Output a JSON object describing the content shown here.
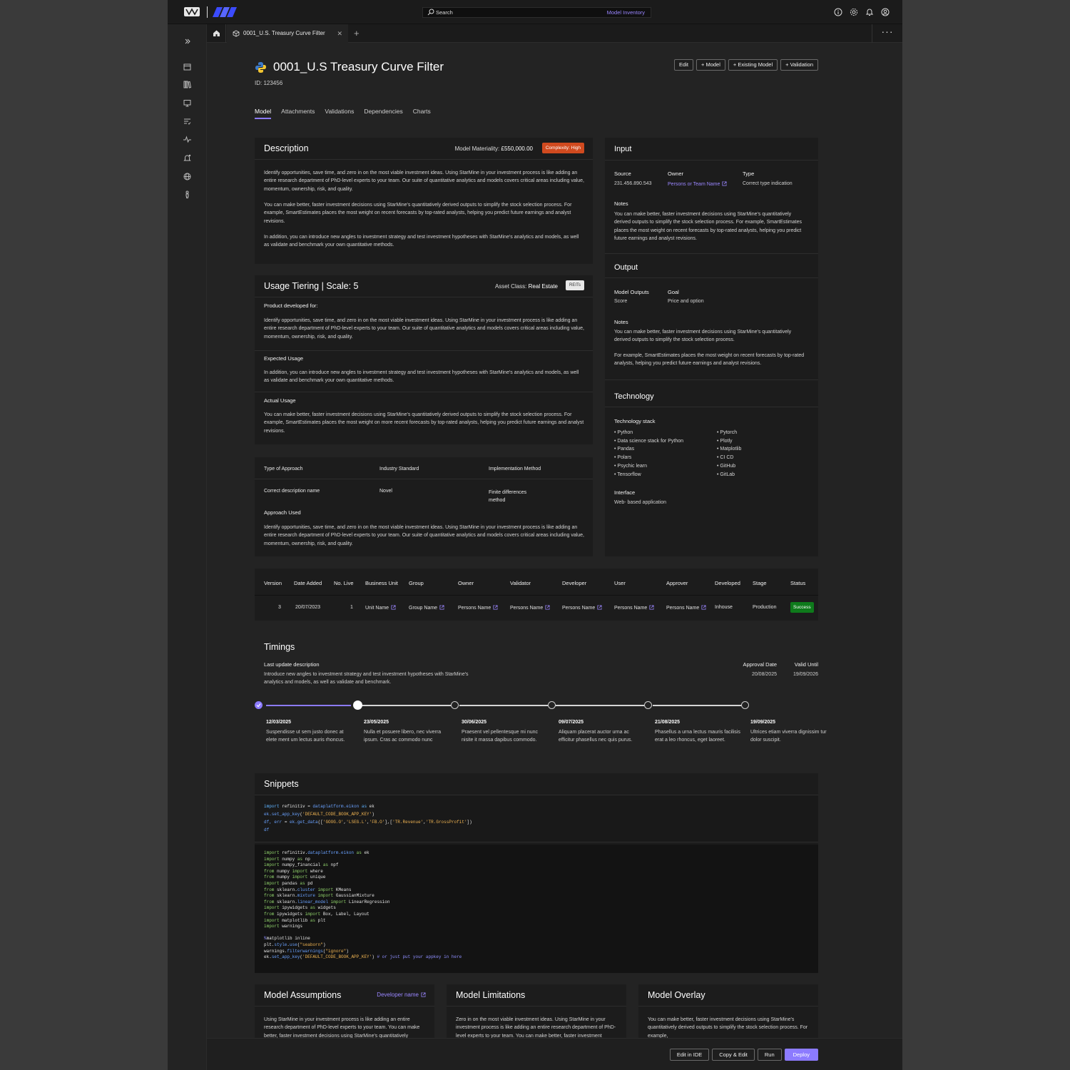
{
  "header": {
    "search_placeholder": "Search",
    "search_scope": "Model Inventory"
  },
  "tabbar": {
    "active_tab": "0001_U.S. Treasury Curve Filter",
    "close": "✕",
    "add": "+",
    "more": "···"
  },
  "page": {
    "title": "0001_U.S Treasury Curve Filter",
    "id": "ID: 123456",
    "actions": [
      "Edit",
      "+ Model",
      "+ Existing Model",
      "+ Validation"
    ],
    "tabs": [
      "Model",
      "Attachments",
      "Validations",
      "Dependencies",
      "Charts"
    ]
  },
  "description": {
    "title": "Description",
    "materiality_label": "Model Materiality:",
    "materiality_value": "£550,000.00",
    "complexity": "Complexity: High",
    "paragraphs": [
      "Identify opportunities, save time, and zero in on the most viable investment ideas. Using StarMine in your investment process is like adding an entire research department of PhD-level experts to your team. Our suite of quantitative analytics and models covers critical areas including value, momentum, ownership, risk, and quality.",
      "You can make better, faster investment decisions using StarMine's quantitatively derived outputs to simplify the stock selection process. For example, SmartEstimates places the most weight on recent forecasts by top-rated analysts, helping you predict future earnings and analyst revisions.",
      "In addition, you can introduce new angles to investment strategy and test investment hypotheses with StarMine's analytics and models, as well as validate and benchmark your own quantitative methods."
    ]
  },
  "usage": {
    "title": "Usage Tiering | Scale: 5",
    "asset_label": "Asset Class:",
    "asset_value": "Real Estate",
    "reits": "REITs",
    "product_label": "Product developed for:",
    "product_text": "Identify opportunities, save time, and zero in on the most viable investment ideas. Using StarMine in your investment process is like adding an entire research department of PhD-level experts to your team. Our suite of quantitative analytics and models covers critical areas including value, momentum, ownership, risk, and quality.",
    "expected_label": "Expected Usage",
    "expected_text": "In addition, you can introduce new angles to investment strategy and test investment hypotheses with StarMine's analytics and models, as well as validate and benchmark your own quantitative methods.",
    "actual_label": "Actual Usage",
    "actual_text": "You can make better, faster investment decisions using StarMine's quantitatively derived outputs to simplify the stock selection process. For example, SmartEstimates places the most weight on more recent forecasts by top-rated analysts, helping you predict future earnings and analyst revisions."
  },
  "approach": {
    "headers": [
      "Type of Approach",
      "Industry Standard",
      "Implementation Method"
    ],
    "values": [
      "Correct description name",
      "Novel",
      "Finite differences method"
    ],
    "used_label": "Approach Used",
    "used_text": "Identify opportunities, save time, and zero in on the most viable investment ideas. Using StarMine in your investment process is like adding an entire research department of PhD-level experts to your team. Our suite of quantitative analytics and models covers critical areas including value, momentum, ownership, risk, and quality."
  },
  "input": {
    "title": "Input",
    "source_label": "Source",
    "source_value": "231.456.890.543",
    "owner_label": "Owner",
    "owner_value": "Persons or Team Name",
    "type_label": "Type",
    "type_value": "Correct type indication",
    "notes_label": "Notes",
    "notes_text": "You can make better, faster investment decisions using StarMine's quantitatively derived outputs to simplify the stock selection process. For example, SmartEstimates places the most weight on recent forecasts by top-rated analysts, helping you predict future earnings and analyst revisions."
  },
  "output": {
    "title": "Output",
    "outputs_label": "Model Outputs",
    "outputs_value": "Score",
    "goal_label": "Goal",
    "goal_value": "Price and option",
    "notes_label": "Notes",
    "notes_text1": "You can make better, faster investment decisions using StarMine's quantitatively derived outputs to simplify the stock selection process.",
    "notes_text2": "For example, SmartEstimates places the most weight on recent forecasts by top-rated analysts, helping you predict future earnings and analyst revisions."
  },
  "technology": {
    "title": "Technology",
    "stack_label": "Technology stack",
    "col1": [
      "• Python",
      "• Data science stack for Python",
      "• Pandas",
      "• Polars",
      "• Psychic learn",
      "• Tensorflow"
    ],
    "col2": [
      "• Pytorch",
      "• Plotly",
      "• Matplotlib",
      "• CI CD",
      "• GitHub",
      "• GitLab"
    ],
    "interface_label": "Interface",
    "interface_value": "Web- based application"
  },
  "versions": {
    "headers": [
      "Version",
      "Date Added",
      "No. Live",
      "Business Unit",
      "Group",
      "Owner",
      "Validator",
      "Developer",
      "User",
      "Approver",
      "Developed",
      "Stage",
      "Status"
    ],
    "row": [
      "3",
      "20/07/2023",
      "1",
      "Unit Name",
      "Group Name",
      "Persons Name",
      "Persons Name",
      "Persons Name",
      "Persons Name",
      "Persons Name",
      "Inhouse",
      "Production",
      "Success"
    ]
  },
  "timings": {
    "title": "Timings",
    "last_update_label": "Last update description",
    "last_update_text": "Introduce new angles to investment strategy and test investment hypotheses with StarMine's analytics and models, as well as validate and benchmark.",
    "approval_label": "Approval Date",
    "approval_value": "20/08/2025",
    "valid_label": "Valid Until",
    "valid_value": "19/09/2026",
    "steps": [
      {
        "date": "12/03/2025",
        "text": "Suspendisse ut sem justo donec at elete ment um lectus auris rhoncus."
      },
      {
        "date": "23/05/2025",
        "text": "Nulla et posuere libero, nec viverra ipsum. Cras ac commodo nunc"
      },
      {
        "date": "30/06/2025",
        "text": "Praesent vel pellentesque mi nunc nisite it massa dapibus commodo."
      },
      {
        "date": "09/07/2025",
        "text": "Aliquam placerat auctor urna ac efficitur phasellus nec quis purus."
      },
      {
        "date": "21/08/2025",
        "text": "Phasellus a urna lectus mauris facilisis erat a leo rhoncus, eget laoreet."
      },
      {
        "date": "19/09/2025",
        "text": "Ultrices etiam viverra dignissim tur dolor suscipit."
      }
    ]
  },
  "snippets": {
    "title": "Snippets",
    "snippet1": [
      "import refinitiv = dataplatform.eikon as ek",
      "ek.set_app_key('DEFAULT_CODE_BOOK_APP_KEY')",
      "df, err = ek.get_data(['GOOG.O','LSEG.L','FB.O'],['TR.Revenue','TR.GrossProfit'])",
      "df"
    ],
    "snippet2": [
      "import refinitiv.dataplatform.eikon as ek",
      "import numpy as np",
      "import numpy_financial as npf",
      "from numpy import where",
      "from numpy import unique",
      "import pandas as pd",
      "from sklearn.cluster import KMeans",
      "from sklearn.mixture import GaussianMixture",
      "from sklearn.linear_model import LinearRegression",
      "import ipywidgets as widgets",
      "from ipywidgets import Box, Label, Layout",
      "import matplotlib as plt",
      "import warnings",
      "",
      "%matplotlib inline",
      "plt.style.use(\"seaborn\")",
      "warnings.filterwarnings(\"ignore\")",
      "ek.set_app_key('DEFAULT_CODE_BOOK_APP_KEY') # or just put your appkey in here"
    ]
  },
  "assumptions": {
    "title": "Model Assumptions",
    "developer": "Developer name",
    "text": "Using StarMine in your investment process is like adding an entire research department of PhD-level experts to your team. You can make better, faster investment decisions using StarMine's quantitatively"
  },
  "limitations": {
    "title": "Model Limitations",
    "text": "Zero in on the most viable investment ideas. Using StarMine in your investment process is like adding an entire research department of PhD-level experts to your team. You can make better, faster investment"
  },
  "overlay": {
    "title": "Model Overlay",
    "text": "You can make better, faster investment decisions using StarMine's quantitatively derived outputs to simplify the stock selection process. For example,"
  },
  "footer": {
    "edit_ide": "Edit in IDE",
    "copy_edit": "Copy & Edit",
    "run": "Run",
    "deploy": "Deploy"
  },
  "colors": {
    "accent": "#8c7bff",
    "complexity_high": "#d04a1f",
    "success": "#0e7a1b"
  }
}
